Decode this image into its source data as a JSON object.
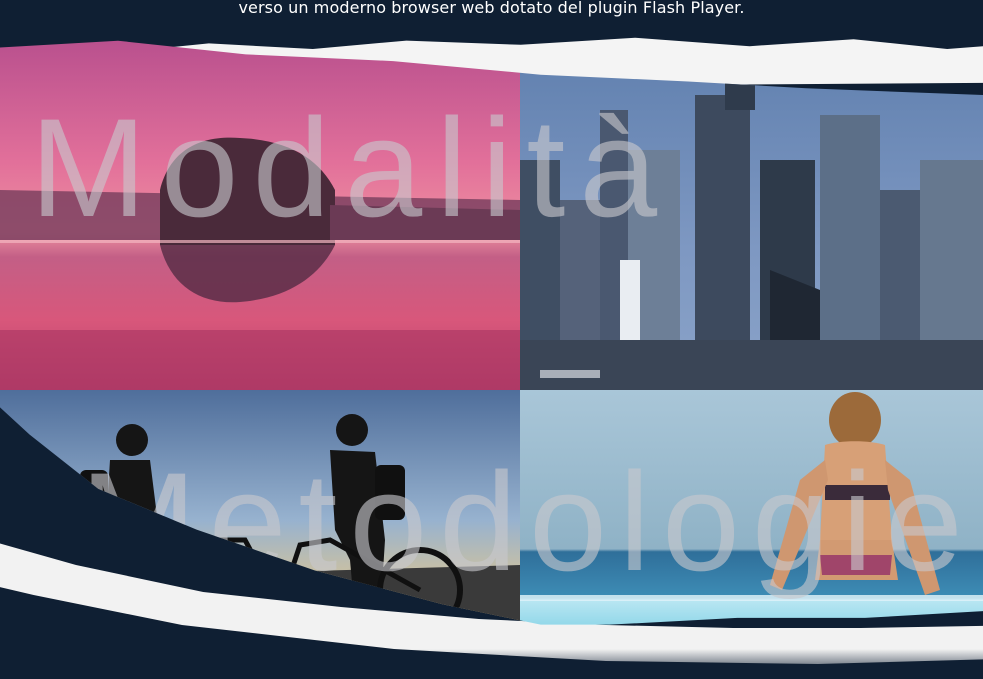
{
  "notice": {
    "text": "verso un moderno browser web dotato del plugin Flash Player."
  },
  "watermarks": {
    "line1": "Modalità",
    "line2": "Metodologie"
  },
  "photos": [
    {
      "icon": "lake-sunset-photo"
    },
    {
      "icon": "city-skyline-photo"
    },
    {
      "icon": "cyclists-silhouette-photo"
    },
    {
      "icon": "infinity-pool-photo"
    }
  ],
  "colors": {
    "background": "#0f1f33",
    "paper": "#f4f4f4",
    "text": "#ffffff",
    "watermark": "#c8c8cd"
  }
}
